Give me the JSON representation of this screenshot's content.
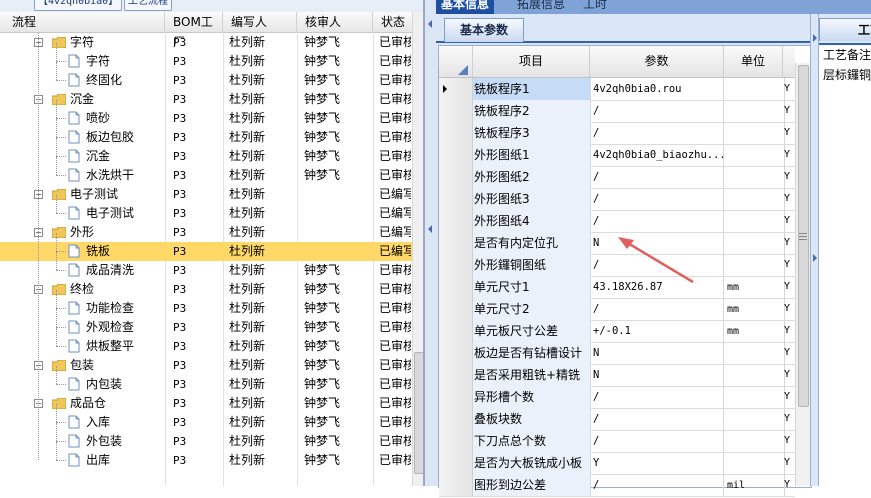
{
  "left_panel": {
    "title_chip": "4v2qh0bia0",
    "title_text": "工艺流程",
    "columns": [
      "流程",
      "BOM工厂",
      "编写人",
      "核审人",
      "状态"
    ],
    "rows": [
      {
        "name": "字符",
        "level": 1,
        "type": "folder",
        "bom": "P3",
        "writer": "杜列新",
        "reviewer": "钟梦飞",
        "status": "已审核"
      },
      {
        "name": "字符",
        "level": 2,
        "type": "doc",
        "bom": "P3",
        "writer": "杜列新",
        "reviewer": "钟梦飞",
        "status": "已审核"
      },
      {
        "name": "终固化",
        "level": 2,
        "type": "doc",
        "bom": "P3",
        "writer": "杜列新",
        "reviewer": "钟梦飞",
        "status": "已审核"
      },
      {
        "name": "沉金",
        "level": 1,
        "type": "folder",
        "bom": "P3",
        "writer": "杜列新",
        "reviewer": "钟梦飞",
        "status": "已审核"
      },
      {
        "name": "喷砂",
        "level": 2,
        "type": "doc",
        "bom": "P3",
        "writer": "杜列新",
        "reviewer": "钟梦飞",
        "status": "已审核"
      },
      {
        "name": "板边包胶",
        "level": 2,
        "type": "doc",
        "bom": "P3",
        "writer": "杜列新",
        "reviewer": "钟梦飞",
        "status": "已审核"
      },
      {
        "name": "沉金",
        "level": 2,
        "type": "doc",
        "bom": "P3",
        "writer": "杜列新",
        "reviewer": "钟梦飞",
        "status": "已审核"
      },
      {
        "name": "水洗烘干",
        "level": 2,
        "type": "doc",
        "bom": "P3",
        "writer": "杜列新",
        "reviewer": "钟梦飞",
        "status": "已审核"
      },
      {
        "name": "电子测试",
        "level": 1,
        "type": "folder",
        "bom": "P3",
        "writer": "杜列新",
        "reviewer": "",
        "status": "已编写"
      },
      {
        "name": "电子测试",
        "level": 2,
        "type": "doc",
        "bom": "P3",
        "writer": "杜列新",
        "reviewer": "",
        "status": "已编写"
      },
      {
        "name": "外形",
        "level": 1,
        "type": "folder",
        "bom": "P3",
        "writer": "杜列新",
        "reviewer": "",
        "status": "已编写"
      },
      {
        "name": "铣板",
        "level": 2,
        "type": "doc",
        "bom": "P3",
        "writer": "杜列新",
        "reviewer": "",
        "status": "已编写",
        "selected": true
      },
      {
        "name": "成品清洗",
        "level": 2,
        "type": "doc",
        "bom": "P3",
        "writer": "杜列新",
        "reviewer": "钟梦飞",
        "status": "已审核"
      },
      {
        "name": "终检",
        "level": 1,
        "type": "folder",
        "bom": "P3",
        "writer": "杜列新",
        "reviewer": "钟梦飞",
        "status": "已审核"
      },
      {
        "name": "功能检查",
        "level": 2,
        "type": "doc",
        "bom": "P3",
        "writer": "杜列新",
        "reviewer": "钟梦飞",
        "status": "已审核"
      },
      {
        "name": "外观检查",
        "level": 2,
        "type": "doc",
        "bom": "P3",
        "writer": "杜列新",
        "reviewer": "钟梦飞",
        "status": "已审核"
      },
      {
        "name": "烘板整平",
        "level": 2,
        "type": "doc",
        "bom": "P3",
        "writer": "杜列新",
        "reviewer": "钟梦飞",
        "status": "已审核"
      },
      {
        "name": "包装",
        "level": 1,
        "type": "folder",
        "bom": "P3",
        "writer": "杜列新",
        "reviewer": "钟梦飞",
        "status": "已审核"
      },
      {
        "name": "内包装",
        "level": 2,
        "type": "doc",
        "bom": "P3",
        "writer": "杜列新",
        "reviewer": "钟梦飞",
        "status": "已审核"
      },
      {
        "name": "成品仓",
        "level": 1,
        "type": "folder",
        "bom": "P3",
        "writer": "杜列新",
        "reviewer": "钟梦飞",
        "status": "已审核"
      },
      {
        "name": "入库",
        "level": 2,
        "type": "doc",
        "bom": "P3",
        "writer": "杜列新",
        "reviewer": "钟梦飞",
        "status": "已审核"
      },
      {
        "name": "外包装",
        "level": 2,
        "type": "doc",
        "bom": "P3",
        "writer": "杜列新",
        "reviewer": "钟梦飞",
        "status": "已审核"
      },
      {
        "name": "出库",
        "level": 2,
        "type": "doc",
        "bom": "P3",
        "writer": "杜列新",
        "reviewer": "钟梦飞",
        "status": "已审核"
      }
    ]
  },
  "right_panel": {
    "top_tabs": [
      "基本信息",
      "拓展信息",
      "工时"
    ],
    "sub_tab": "基本参数",
    "columns": [
      "项目",
      "参数",
      "单位"
    ],
    "rows": [
      {
        "name": "铣板程序1",
        "value": "4v2qh0bia0.rou",
        "unit": "",
        "flag": "Y",
        "current": true
      },
      {
        "name": "铣板程序2",
        "value": "/",
        "unit": "",
        "flag": "Y"
      },
      {
        "name": "铣板程序3",
        "value": "/",
        "unit": "",
        "flag": "Y"
      },
      {
        "name": "外形图纸1",
        "value": "4v2qh0bia0_biaozhu...",
        "unit": "",
        "flag": "Y"
      },
      {
        "name": "外形图纸2",
        "value": "/",
        "unit": "",
        "flag": "Y"
      },
      {
        "name": "外形图纸3",
        "value": "/",
        "unit": "",
        "flag": "Y"
      },
      {
        "name": "外形图纸4",
        "value": "/",
        "unit": "",
        "flag": "Y"
      },
      {
        "name": "是否有内定位孔",
        "value": "N",
        "unit": "",
        "flag": "Y"
      },
      {
        "name": "外形鑼铜图纸",
        "value": "/",
        "unit": "",
        "flag": "Y"
      },
      {
        "name": "单元尺寸1",
        "value": "43.18X26.87",
        "unit": "mm",
        "flag": "Y"
      },
      {
        "name": "单元尺寸2",
        "value": "/",
        "unit": "mm",
        "flag": "Y"
      },
      {
        "name": "单元板尺寸公差",
        "value": "+/-0.1",
        "unit": "mm",
        "flag": "Y"
      },
      {
        "name": "板边是否有钻槽设计",
        "value": "N",
        "unit": "",
        "flag": "Y"
      },
      {
        "name": "是否采用粗铣+精铣",
        "value": "N",
        "unit": "",
        "flag": "Y"
      },
      {
        "name": "异形槽个数",
        "value": "/",
        "unit": "",
        "flag": "Y"
      },
      {
        "name": "叠板块数",
        "value": "/",
        "unit": "",
        "flag": "Y"
      },
      {
        "name": "下刀点总个数",
        "value": "/",
        "unit": "",
        "flag": "Y"
      },
      {
        "name": "是否为大板铣成小板",
        "value": "Y",
        "unit": "",
        "flag": "Y"
      },
      {
        "name": "图形到边公差",
        "value": "/",
        "unit": "mil",
        "flag": "Y"
      }
    ]
  },
  "far_panel": {
    "tab": "工艺备注",
    "lines": [
      "工艺备注",
      "层标鑼铜"
    ]
  },
  "colors": {
    "selected_row": "#ffd867",
    "tab_active": "#1e4fa0",
    "arrow": "#e06060"
  }
}
